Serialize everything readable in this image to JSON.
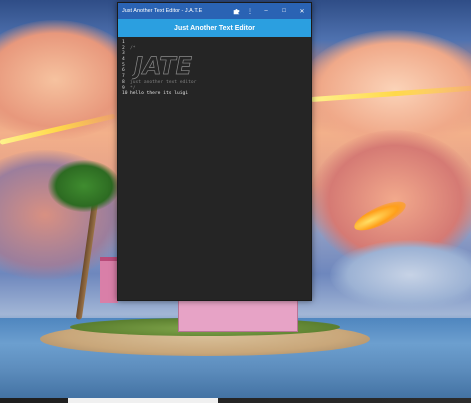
{
  "window": {
    "title": "Just Another Text Editor - J.A.T.E",
    "header": "Just Another Text Editor",
    "controls": {
      "extension_icon": "puzzle-icon",
      "menu_icon": "kebab-icon",
      "minimize": "–",
      "maximize": "□",
      "close": "✕",
      "menu_glyph": "⋮"
    }
  },
  "editor": {
    "lines": [
      {
        "number": "1",
        "text": ""
      },
      {
        "number": "2",
        "text": "/*"
      },
      {
        "number": "3",
        "text": ""
      },
      {
        "number": "4",
        "text": ""
      },
      {
        "number": "5",
        "text": ""
      },
      {
        "number": "6",
        "text": ""
      },
      {
        "number": "7",
        "text": ""
      },
      {
        "number": "8",
        "text": "just another text editor"
      },
      {
        "number": "9",
        "text": "*/"
      },
      {
        "number": "10",
        "text": "hello there its luigi"
      }
    ],
    "logo_text": "JATE"
  },
  "colors": {
    "titlebar": "#2a63b4",
    "header": "#2b9fe0",
    "editor_bg": "#252525"
  }
}
